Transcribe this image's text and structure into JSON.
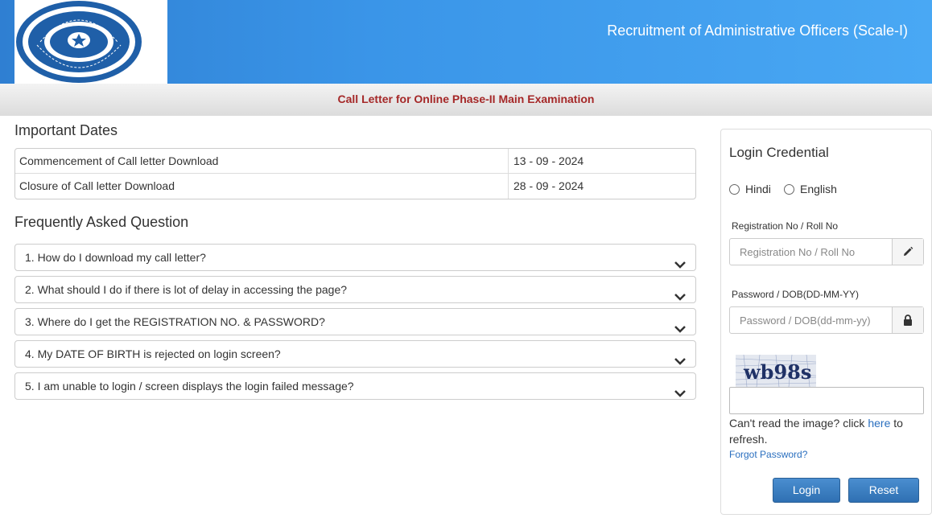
{
  "header": {
    "title": "Recruitment of Administrative Officers (Scale-I)",
    "logo_text_top": "दि ओरिएन्टल इंश्योरेंस कम्पनी लिमिटेड",
    "logo_text_bottom": "THE ORIENTAL INSURANCE COMPANY LIMITED",
    "logo_motto": "HEAVEN'S LIGHT OUR GUIDE"
  },
  "subheader": {
    "title": "Call Letter for Online Phase-II Main Examination"
  },
  "important_dates": {
    "heading": "Important Dates",
    "rows": [
      {
        "label": "Commencement of Call letter Download",
        "value": "13 - 09 - 2024"
      },
      {
        "label": "Closure of Call letter Download",
        "value": "28 - 09 - 2024"
      }
    ]
  },
  "faq": {
    "heading": "Frequently Asked Question",
    "items": [
      "1. How do I download my call letter?",
      "2. What should I do if there is lot of delay in accessing the page?",
      "3. Where do I get the REGISTRATION NO. & PASSWORD?",
      "4. My DATE OF BIRTH is rejected on login screen?",
      "5. I am unable to login / screen displays the login failed message?"
    ]
  },
  "login": {
    "title": "Login Credential",
    "lang_hindi": "Hindi",
    "lang_english": "English",
    "reg_label": "Registration No / Roll No",
    "reg_placeholder": "Registration No / Roll No",
    "pwd_label": "Password / DOB(DD-MM-YY)",
    "pwd_placeholder": "Password / DOB(dd-mm-yy)",
    "captcha_text": "wb98s",
    "refresh_prefix": "Can't read the image? click ",
    "refresh_link": "here",
    "refresh_suffix": " to refresh.",
    "forgot": "Forgot Password?",
    "login_button": "Login",
    "reset_button": "Reset"
  },
  "colors": {
    "header_blue": "#3a95e8",
    "subheader_red": "#a52828",
    "button_blue": "#2f70b3",
    "link_blue": "#2a6fbf"
  }
}
